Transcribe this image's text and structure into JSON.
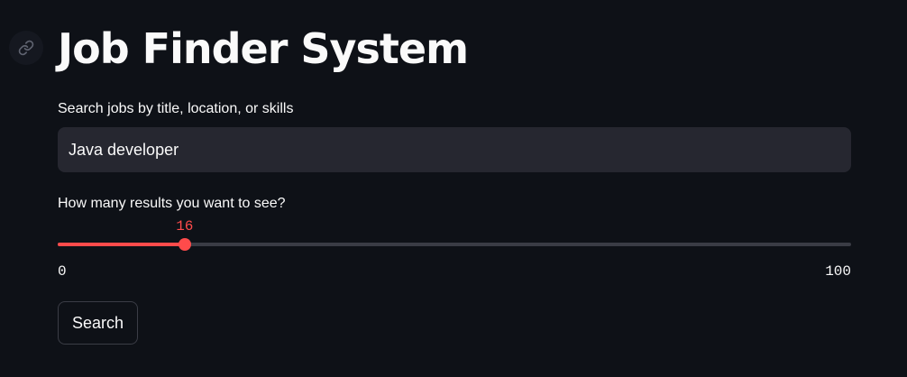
{
  "header": {
    "title": "Job Finder System",
    "anchor_icon": "link-icon"
  },
  "search": {
    "label": "Search jobs by title, location, or skills",
    "value": "Java developer",
    "placeholder": ""
  },
  "results_slider": {
    "label": "How many results you want to see?",
    "value": 16,
    "min": 0,
    "max": 100,
    "value_label": "16",
    "min_label": "0",
    "max_label": "100"
  },
  "actions": {
    "search_label": "Search"
  },
  "colors": {
    "background": "#0e1117",
    "accent": "#ff4b4b",
    "input_background": "#262730",
    "text": "#fafafa"
  }
}
